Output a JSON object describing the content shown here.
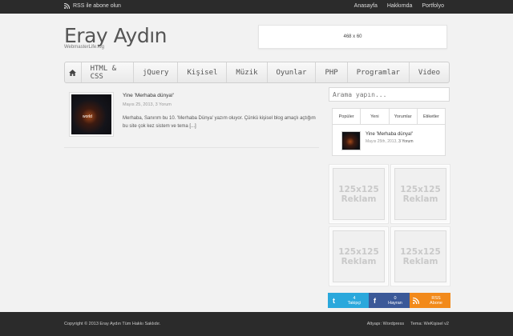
{
  "topbar": {
    "rss_label": "RSS ile abone olun",
    "links": [
      "Anasayfa",
      "Hakkımda",
      "Portfolyo"
    ]
  },
  "header": {
    "logo": "Eray Aydın",
    "tagline": "WebmasterLife.log",
    "banner_text": "468 x 60"
  },
  "nav": {
    "items": [
      "HTML & CSS",
      "jQuery",
      "Kişisel",
      "Müzik",
      "Oyunlar",
      "PHP",
      "Programlar",
      "Video"
    ]
  },
  "post": {
    "title": "Yine 'Merhaba dünya!'",
    "meta": "Mayıs 25, 2013, 3 Yorum",
    "excerpt": "Merhaba, Sanırım bu 10. 'Merhaba Dünya' yazım oluyor. Çünkü kişisel blog amaçlı açtığım bu site çok kez sistem ve tema [...]",
    "thumb_text": "world"
  },
  "sidebar": {
    "search_placeholder": "Arama yapın...",
    "tabs": [
      "Popüler",
      "Yeni",
      "Yorumlar",
      "Etiketler"
    ],
    "tab_item": {
      "title": "Yine 'Merhaba dünya!'",
      "date": "Mayıs 25th, 2013,",
      "comments": "3 Yorum"
    },
    "ads": [
      {
        "size": "125x125",
        "label": "Reklam"
      },
      {
        "size": "125x125",
        "label": "Reklam"
      },
      {
        "size": "125x125",
        "label": "Reklam"
      },
      {
        "size": "125x125",
        "label": "Reklam"
      }
    ],
    "social": {
      "twitter": {
        "count": "4",
        "label": "Takipçi",
        "color": "#2aa8dc"
      },
      "facebook": {
        "count": "0",
        "label": "Hayran",
        "color": "#3b5998"
      },
      "rss": {
        "count": "RSS",
        "label": "Abone",
        "color": "#f28a1b"
      }
    }
  },
  "footer": {
    "copyright": "Copyright © 2013 Eray Aydın Tüm Hakkı Saklıdır.",
    "powered": "Altyapı: Wordpress",
    "theme": "Tema: WeKişisel v2"
  }
}
